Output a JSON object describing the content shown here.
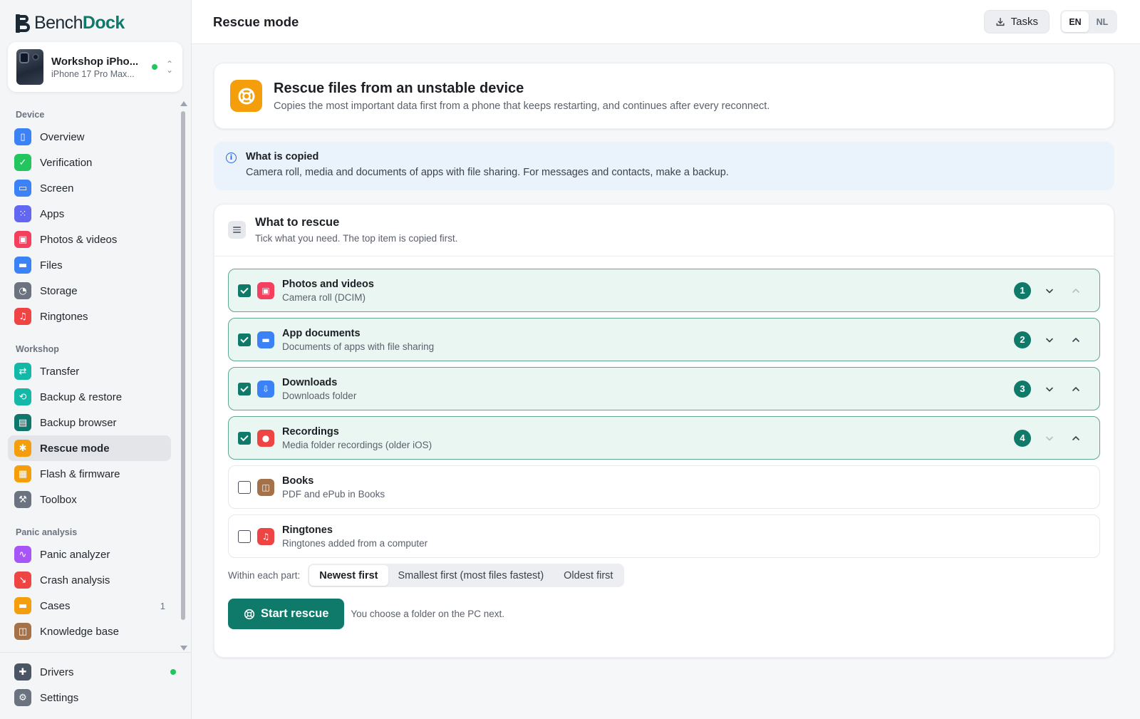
{
  "brand": {
    "name_part1": "Bench",
    "name_part2": "Dock"
  },
  "device": {
    "name": "Workshop iPho...",
    "model": "iPhone 17 Pro Max...",
    "status_color": "#22c55e"
  },
  "sidebar": {
    "sections": [
      {
        "title": "Device",
        "items": [
          {
            "label": "Overview",
            "icon": "phone-icon",
            "color": "#3b82f6"
          },
          {
            "label": "Verification",
            "icon": "shield-check-icon",
            "color": "#22c55e"
          },
          {
            "label": "Screen",
            "icon": "screen-icon",
            "color": "#3b82f6"
          },
          {
            "label": "Apps",
            "icon": "apps-grid-icon",
            "color": "#6366f1"
          },
          {
            "label": "Photos & videos",
            "icon": "photo-icon",
            "color": "#f43f5e"
          },
          {
            "label": "Files",
            "icon": "folder-icon",
            "color": "#3b82f6"
          },
          {
            "label": "Storage",
            "icon": "pie-chart-icon",
            "color": "#6b7280"
          },
          {
            "label": "Ringtones",
            "icon": "music-note-icon",
            "color": "#ef4444"
          }
        ]
      },
      {
        "title": "Workshop",
        "items": [
          {
            "label": "Transfer",
            "icon": "transfer-arrows-icon",
            "color": "#14b8a6"
          },
          {
            "label": "Backup & restore",
            "icon": "backup-icon",
            "color": "#14b8a6"
          },
          {
            "label": "Backup browser",
            "icon": "archive-icon",
            "color": "#0f766e"
          },
          {
            "label": "Rescue mode",
            "icon": "lifebuoy-icon",
            "color": "#f59e0b",
            "active": true
          },
          {
            "label": "Flash & firmware",
            "icon": "chip-icon",
            "color": "#f59e0b"
          },
          {
            "label": "Toolbox",
            "icon": "wrench-icon",
            "color": "#6b7280"
          }
        ]
      },
      {
        "title": "Panic analysis",
        "items": [
          {
            "label": "Panic analyzer",
            "icon": "pulse-icon",
            "color": "#a855f7"
          },
          {
            "label": "Crash analysis",
            "icon": "chart-down-icon",
            "color": "#ef4444"
          },
          {
            "label": "Cases",
            "icon": "folder-case-icon",
            "color": "#f59e0b",
            "count": "1"
          },
          {
            "label": "Knowledge base",
            "icon": "book-icon",
            "color": "#a47148"
          }
        ]
      }
    ],
    "footer": [
      {
        "label": "Drivers",
        "icon": "puzzle-icon",
        "color": "#4b5563",
        "status_color": "#22c55e"
      },
      {
        "label": "Settings",
        "icon": "gear-icon",
        "color": "#6b7280"
      }
    ]
  },
  "header": {
    "title": "Rescue mode",
    "tasks_label": "Tasks",
    "languages": [
      {
        "code": "EN",
        "active": true
      },
      {
        "code": "NL",
        "active": false
      }
    ]
  },
  "hero": {
    "title": "Rescue files from an unstable device",
    "subtitle": "Copies the most important data first from a phone that keeps restarting, and continues after every reconnect."
  },
  "info": {
    "title": "What is copied",
    "text": "Camera roll, media and documents of apps with file sharing. For messages and contacts, make a backup."
  },
  "rescue": {
    "title": "What to rescue",
    "subtitle": "Tick what you need. The top item is copied first.",
    "items": [
      {
        "title": "Photos and videos",
        "subtitle": "Camera roll (DCIM)",
        "checked": true,
        "order": "1",
        "icon": "photo-icon",
        "color": "#f43f5e",
        "up_enabled": false,
        "down_enabled": true
      },
      {
        "title": "App documents",
        "subtitle": "Documents of apps with file sharing",
        "checked": true,
        "order": "2",
        "icon": "folder-icon",
        "color": "#3b82f6",
        "up_enabled": true,
        "down_enabled": true
      },
      {
        "title": "Downloads",
        "subtitle": "Downloads folder",
        "checked": true,
        "order": "3",
        "icon": "download-icon",
        "color": "#3b82f6",
        "up_enabled": true,
        "down_enabled": true
      },
      {
        "title": "Recordings",
        "subtitle": "Media folder recordings (older iOS)",
        "checked": true,
        "order": "4",
        "icon": "microphone-icon",
        "color": "#ef4444",
        "up_enabled": true,
        "down_enabled": false
      },
      {
        "title": "Books",
        "subtitle": "PDF and ePub in Books",
        "checked": false,
        "icon": "book-icon",
        "color": "#a47148"
      },
      {
        "title": "Ringtones",
        "subtitle": "Ringtones added from a computer",
        "checked": false,
        "icon": "music-note-icon",
        "color": "#ef4444"
      }
    ],
    "sort_label": "Within each part:",
    "sort_options": [
      {
        "label": "Newest first",
        "active": true
      },
      {
        "label": "Smallest first (most files fastest)",
        "active": false
      },
      {
        "label": "Oldest first",
        "active": false
      }
    ],
    "start_label": "Start rescue",
    "start_hint": "You choose a folder on the PC next."
  },
  "colors": {
    "accent": "#0f7a6a",
    "info_bg": "#eaf2fc",
    "checked_bg": "#eaf6f2"
  }
}
